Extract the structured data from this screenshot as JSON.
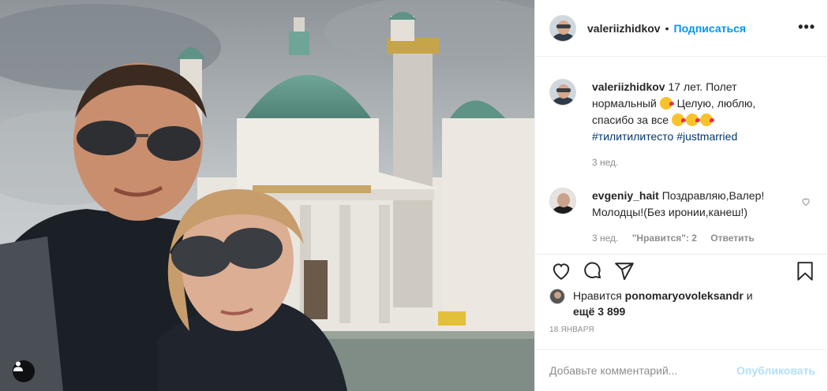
{
  "header": {
    "username": "valeriizhidkov",
    "separator": "•",
    "follow_label": "Подписаться",
    "more_label": "•••"
  },
  "caption": {
    "username": "valeriizhidkov",
    "text_1": "17 лет. Полет нормальный",
    "text_2": "Целую, люблю, спасибо за все",
    "hashtag_1": "#тилитилитесто",
    "hashtag_2": "#justmarried",
    "time": "3 нед."
  },
  "comments": [
    {
      "username": "evgeniy_hait",
      "text": "Поздравляю,Валер! Молодцы!(Без иронии,канеш!)",
      "time": "3 нед.",
      "likes": "\"Нравится\": 2",
      "reply_label": "Ответить"
    }
  ],
  "likes": {
    "prefix": "Нравится",
    "user": "ponomaryovoleksandr",
    "connector": "и",
    "count": "ещё 3 899"
  },
  "date": "18 ЯНВАРЯ",
  "add_comment": {
    "placeholder": "Добавьте комментарий...",
    "publish_label": "Опубликовать"
  },
  "colors": {
    "link_blue": "#0095f6",
    "publish_disabled": "#b2dffc",
    "meta_gray": "#8e8e8e",
    "hashtag": "#00376b"
  },
  "icons": [
    "heart-icon",
    "comment-icon",
    "share-icon",
    "bookmark-icon",
    "more-icon",
    "user-tag-icon"
  ]
}
